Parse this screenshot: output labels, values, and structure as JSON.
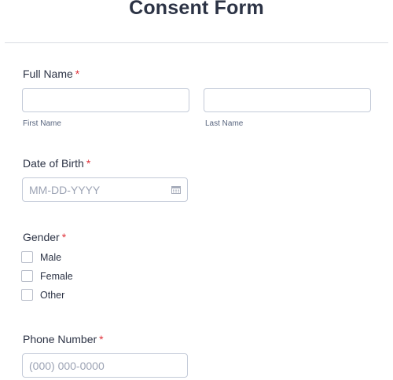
{
  "form": {
    "title": "Consent Form"
  },
  "full_name": {
    "label": "Full Name",
    "required_mark": "*",
    "first_sublabel": "First Name",
    "last_sublabel": "Last Name",
    "first_value": "",
    "last_value": ""
  },
  "dob": {
    "label": "Date of Birth",
    "required_mark": "*",
    "placeholder": "MM-DD-YYYY",
    "icon": "calendar-icon"
  },
  "gender": {
    "label": "Gender",
    "required_mark": "*",
    "options": [
      "Male",
      "Female",
      "Other"
    ]
  },
  "phone": {
    "label": "Phone Number",
    "required_mark": "*",
    "placeholder": "(000) 000-0000"
  },
  "colors": {
    "text": "#2c3345",
    "required": "#e0343c",
    "border": "#c3cad8",
    "placeholder": "#9ca3b4"
  }
}
